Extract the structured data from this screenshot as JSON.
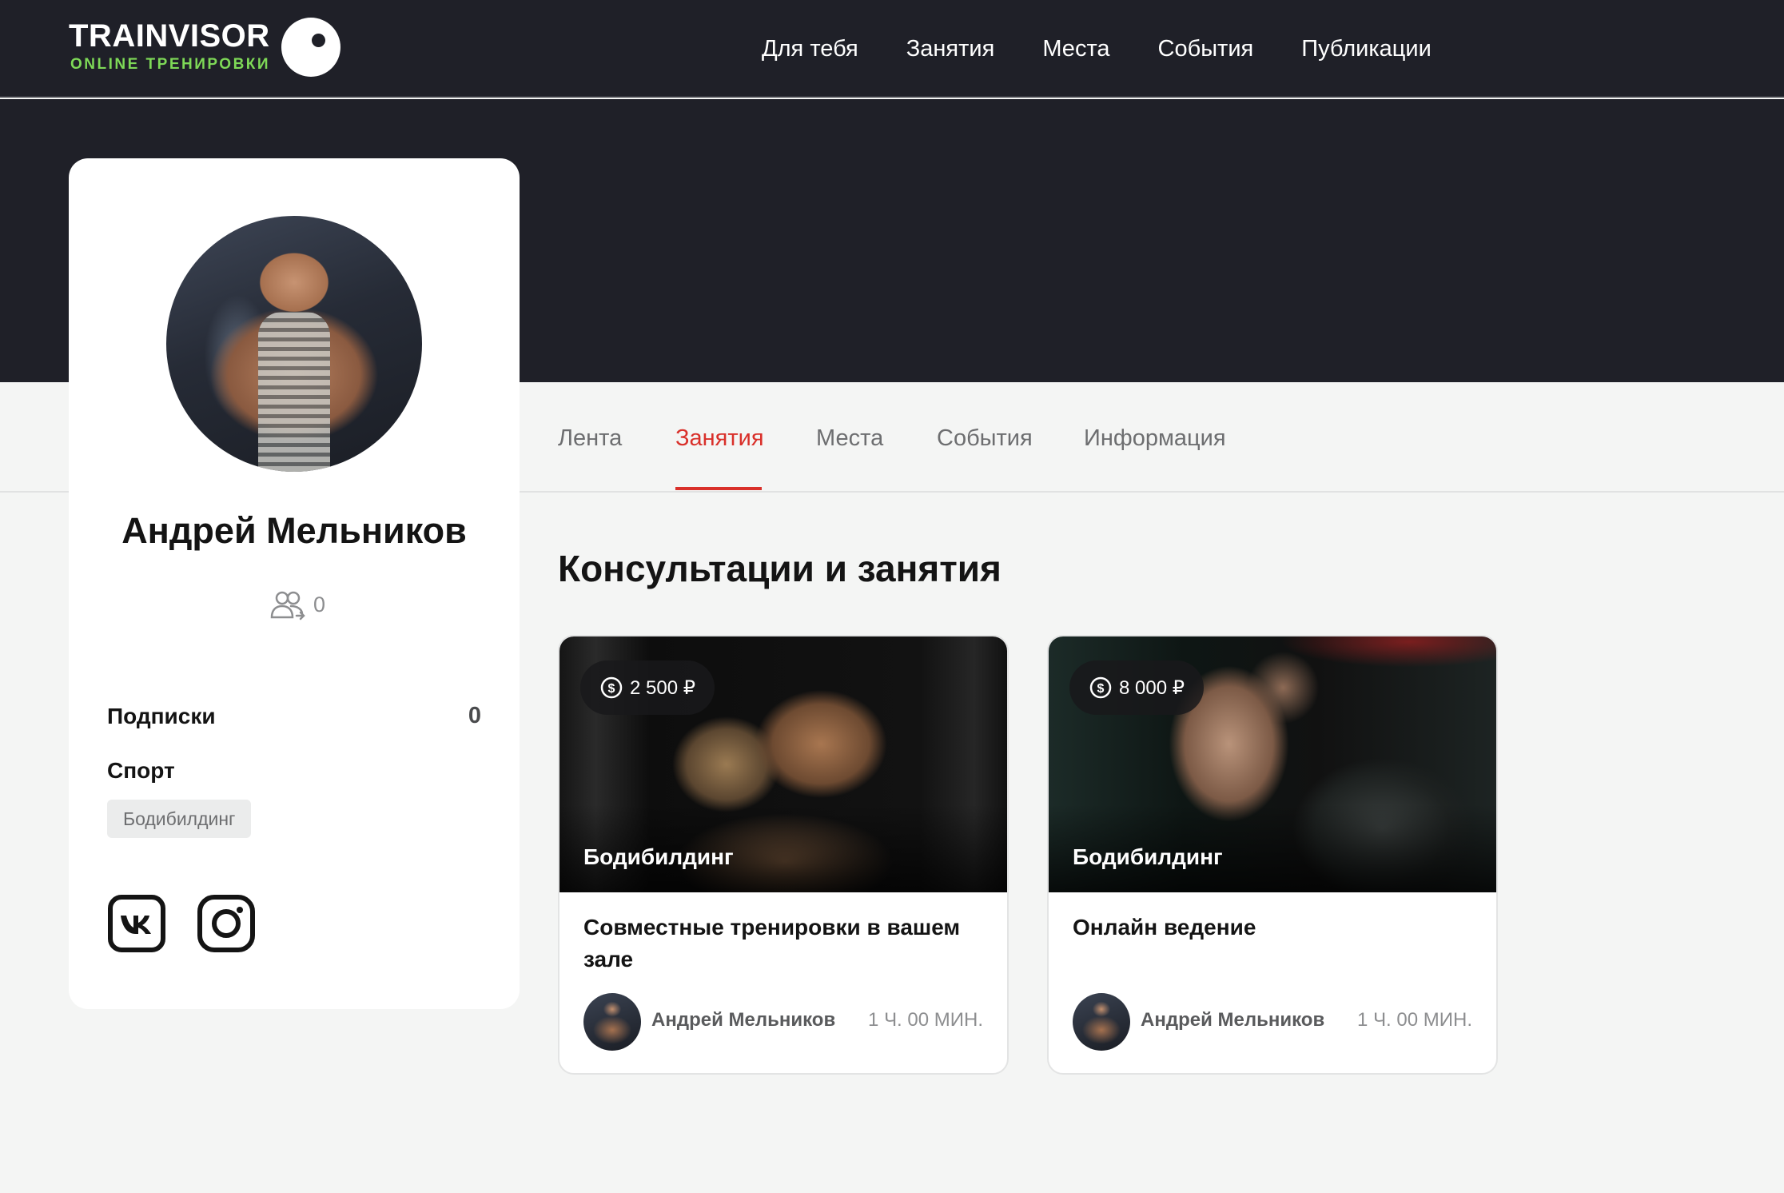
{
  "brand": {
    "name": "TRAINVISOR",
    "tagline": "ONLINE ТРЕНИРОВКИ",
    "accent_color": "#7ed957",
    "icon": "eye-logo-icon"
  },
  "nav": {
    "items": [
      {
        "label": "Для тебя"
      },
      {
        "label": "Занятия"
      },
      {
        "label": "Места"
      },
      {
        "label": "События"
      },
      {
        "label": "Публикации"
      }
    ]
  },
  "profile": {
    "name": "Андрей Мельников",
    "followers_count": "0",
    "followers_icon": "users-icon",
    "subscriptions_label": "Подписки",
    "subscriptions_value": "0",
    "sport_label": "Спорт",
    "sport_tag": "Бодибилдинг",
    "social": [
      {
        "icon": "vk-icon"
      },
      {
        "icon": "instagram-icon"
      }
    ]
  },
  "tabs": {
    "items": [
      {
        "label": "Лента"
      },
      {
        "label": "Занятия"
      },
      {
        "label": "Места"
      },
      {
        "label": "События"
      },
      {
        "label": "Информация"
      }
    ],
    "active": "Занятия",
    "active_color": "#d9302a"
  },
  "section": {
    "title": "Консультации и занятия"
  },
  "cards": [
    {
      "price": "2 500 ₽",
      "sport": "Бодибилдинг",
      "title": "Совместные тренировки в вашем зале",
      "author": "Андрей Мельников",
      "duration": "1 Ч. 00 МИН."
    },
    {
      "price": "8 000 ₽",
      "sport": "Бодибилдинг",
      "title": "Онлайн ведение",
      "author": "Андрей Мельников",
      "duration": "1 Ч. 00 МИН."
    }
  ]
}
